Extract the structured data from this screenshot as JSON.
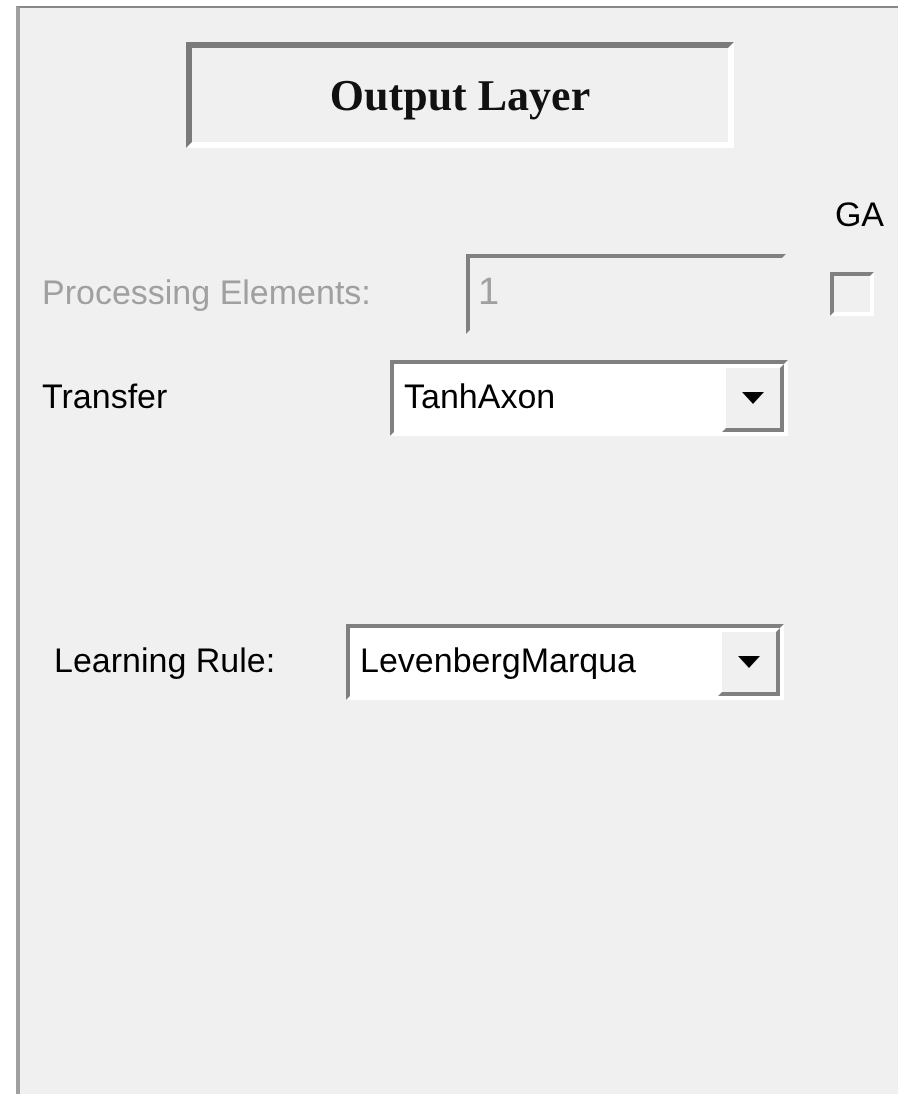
{
  "title": "Output Layer",
  "ga": {
    "label": "GA",
    "checked": false
  },
  "processing_elements": {
    "label": "Processing Elements:",
    "value": "1",
    "disabled": true
  },
  "transfer": {
    "label": "Transfer",
    "value": "TanhAxon"
  },
  "learning_rule": {
    "label": "Learning Rule:",
    "value": "LevenbergMarqua"
  }
}
